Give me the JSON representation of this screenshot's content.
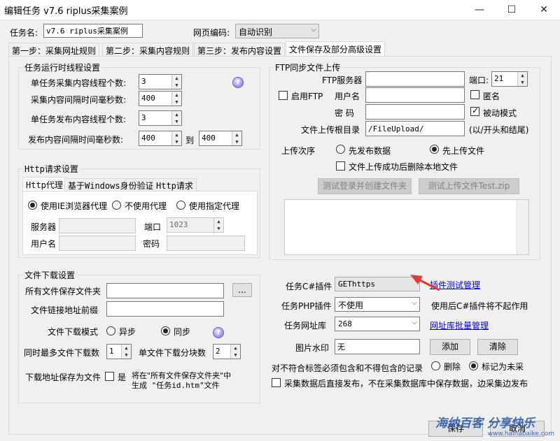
{
  "window": {
    "title": "编辑任务 v7.6 riplus采集案例",
    "minimize": "—",
    "maximize": "☐",
    "close": "✕"
  },
  "task_name": {
    "label": "任务名:",
    "value": "v7.6 riplus采集案例"
  },
  "encoding": {
    "label": "网页编码:",
    "value": "自动识别"
  },
  "tabs": [
    "第一步：采集网址规则",
    "第二步：采集内容规则",
    "第三步：发布内容设置",
    "文件保存及部分高级设置"
  ],
  "thread": {
    "title": "任务运行时线程设置",
    "l1": "单任务采集内容线程个数:",
    "v1": "3",
    "l2": "采集内容间隔时间毫秒数:",
    "v2": "400",
    "l3": "单任务发布内容线程个数:",
    "v3": "3",
    "l4": "发布内容间隔时间毫秒数:",
    "v4a": "400",
    "to": "到",
    "v4b": "400"
  },
  "http": {
    "title": "Http请求设置",
    "tabs": [
      "Http代理",
      "基于Windows身份验证",
      "Http请求"
    ],
    "r1": "使用IE浏览器代理",
    "r2": "不使用代理",
    "r3": "使用指定代理",
    "server": "服务器",
    "port": "端口",
    "port_value": "1023",
    "user": "用户名",
    "pass": "密码"
  },
  "download": {
    "title": "文件下载设置",
    "save_label": "所有文件保存文件夹",
    "browse": "...",
    "prefix_label": "文件链接地址前缀",
    "mode_label": "文件下载模式",
    "async": "异步",
    "sync": "同步",
    "max_label": "同时最多文件下载数",
    "max_value": "1",
    "chunk_label": "单文件下载分块数",
    "chunk_value": "2",
    "save_as_label": "下载地址保存为文件",
    "yes": "是",
    "note1": "将在\"所有文件保存文件夹\"中",
    "note2": "生成 \"任务id.htm\"文件"
  },
  "ftp": {
    "title": "FTP同步文件上传",
    "server": "FTP服务器",
    "port": "端口:",
    "port_value": "21",
    "enable": "启用FTP",
    "user": "用户名",
    "anon": "匿名",
    "pass": "密 码",
    "passive": "被动模式",
    "root_label": "文件上传根目录",
    "root_value": "/FileUpload/",
    "root_hint": "(以/开头和结尾)",
    "order_label": "上传次序",
    "first_publish": "先发布数据",
    "first_upload": "先上传文件",
    "delete_local": "文件上传成功后删除本地文件",
    "test_login": "测试登录并创建文件夹",
    "test_upload": "测试上传文件Test.zip"
  },
  "plugins": {
    "cs_label": "任务C#插件",
    "cs_value": "GEThttps",
    "cs_link": "插件测试管理",
    "php_label": "任务PHP插件",
    "php_value": "不使用",
    "php_note": "使用后C#插件将不起作用",
    "lib_label": "任务网址库",
    "lib_value": "268",
    "lib_link": "网址库批量管理",
    "wm_label": "图片水印",
    "wm_value": "无",
    "add": "添加",
    "clear": "清除"
  },
  "records": {
    "label": "对不符合标签必须包含和不得包含的记录",
    "delete": "删除",
    "mark": "标记为未采"
  },
  "direct": {
    "label": "采集数据后直接发布，不在采集数据库中保存数据，边采集边发布"
  },
  "footer": {
    "save": "保存",
    "cancel": "取消",
    "watermark": "海纳百客 分享快乐",
    "watermark_url": "www.hainabaike.com"
  },
  "colors": {
    "arrow": "#e53935",
    "link": "#0000ee",
    "watermark": "#2255aa"
  }
}
